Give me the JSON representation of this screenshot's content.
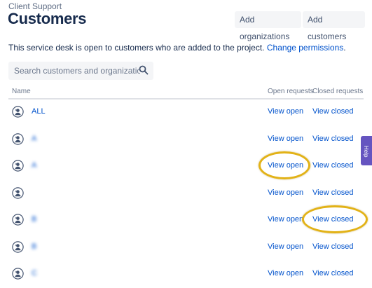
{
  "breadcrumb": "Client Support",
  "page_title": "Customers",
  "buttons": {
    "add_organizations": "Add organizations",
    "add_customers": "Add customers"
  },
  "info": {
    "text": "This service desk is open to customers who are added to the project.",
    "link": "Change permissions",
    "suffix": "."
  },
  "search": {
    "placeholder": "Search customers and organizations"
  },
  "table": {
    "headers": {
      "name": "Name",
      "open": "Open requests",
      "closed": "Closed requests"
    },
    "rows": [
      {
        "name": "ALL",
        "open": "View open",
        "closed": "View closed"
      },
      {
        "name": "A",
        "open": "View open",
        "closed": "View closed"
      },
      {
        "name": "A",
        "open": "View open",
        "closed": "View closed"
      },
      {
        "name": "",
        "open": "View open",
        "closed": "View closed"
      },
      {
        "name": "B",
        "open": "View open",
        "closed": "View closed"
      },
      {
        "name": "B",
        "open": "View open",
        "closed": "View closed"
      },
      {
        "name": "C",
        "open": "View open",
        "closed": "View closed"
      }
    ]
  },
  "help_tab": "Help",
  "colors": {
    "link": "#0052cc",
    "highlight": "#e2b217",
    "help": "#6554c0"
  }
}
